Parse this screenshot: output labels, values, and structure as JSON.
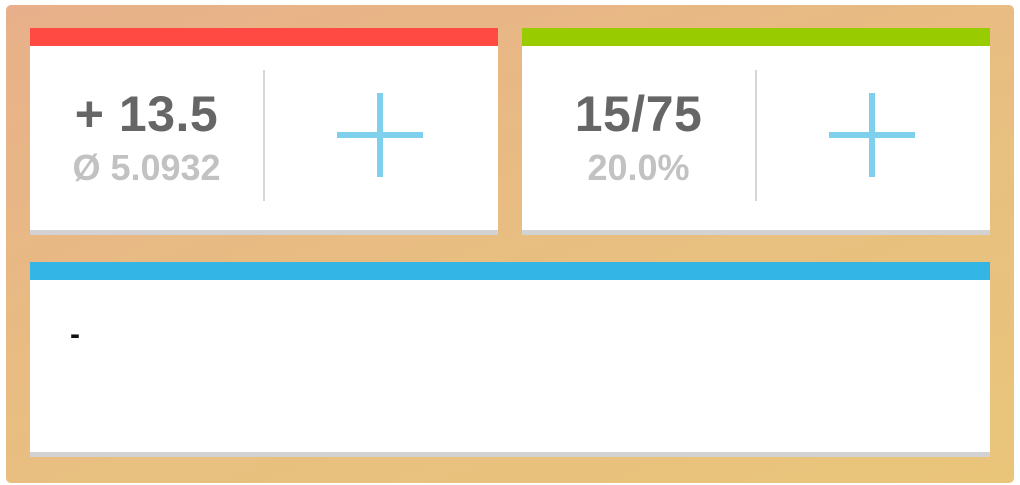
{
  "colors": {
    "background_start": "#e8b08a",
    "background_end": "#e9c57a",
    "left_card_accent": "#ff4a44",
    "right_card_accent": "#99cc00",
    "bottom_card_accent": "#33b5e5",
    "plus_icon": "#7fd0ec",
    "main_text": "#666666",
    "sub_text": "#c2c2c2"
  },
  "left_card": {
    "value": "+ 13.5",
    "average": "Ø 5.0932",
    "add_icon": "plus-icon"
  },
  "right_card": {
    "value": "15/75",
    "percent": "20.0%",
    "add_icon": "plus-icon"
  },
  "bottom_card": {
    "text": "-"
  }
}
